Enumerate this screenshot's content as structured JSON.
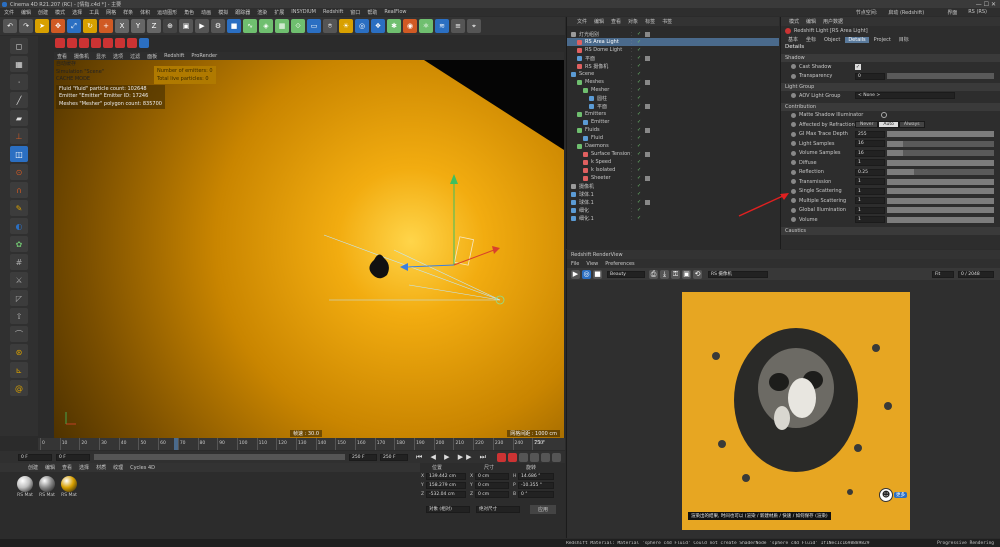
{
  "window": {
    "title": "Cinema 4D R21.207 (RC) - [情指.c4d *] - 主要"
  },
  "menu": [
    "文件",
    "编辑",
    "创建",
    "模式",
    "选择",
    "工具",
    "网格",
    "样条",
    "体积",
    "运动图形",
    "角色",
    "动画",
    "模拟",
    "跟踪器",
    "渲染",
    "扩展",
    "INSYDIUM",
    "Redshift",
    "窗口",
    "帮助",
    "RealFlow"
  ],
  "top_right": {
    "layout_label": "界面",
    "layout_value": "启动 (Redshift)",
    "node_label": "节点空间:",
    "node_value": "RS (RS)"
  },
  "viewport": {
    "menu": [
      "查看",
      "摄像机",
      "显示",
      "选项",
      "过滤",
      "面板",
      "Redshift",
      "ProRender"
    ],
    "sim_info": [
      "Simulation \"Scene\"",
      "CACHE MODE",
      "Fluid \"fluid\" particle count: 102648",
      "Emitter \"Emitter\" Emitter ID: 17246",
      "Meshes \"Mesher\" polygon count: 835700"
    ],
    "sim_info_title": "自动缓存",
    "emitters_label": "Number of emitters: 0",
    "particles_label": "Total live particles: 0",
    "speed_label": "帧速 : 30.0",
    "grid_label": "网格间距 : 1000 cm"
  },
  "timeline": {
    "ticks": [
      "0",
      "10",
      "20",
      "30",
      "40",
      "50",
      "60",
      "70",
      "80",
      "90",
      "100",
      "110",
      "120",
      "130",
      "140",
      "150",
      "160",
      "170",
      "180",
      "190",
      "200",
      "210",
      "220",
      "230",
      "240",
      "250"
    ],
    "current_frame": "73 F",
    "start": "0 F",
    "start2": "0 F",
    "end": "250 F",
    "end2": "250 F"
  },
  "materials": {
    "menu": [
      "创建",
      "编辑",
      "查看",
      "选择",
      "材质",
      "纹理",
      "Cycles 4D"
    ],
    "items": [
      {
        "name": "RS Mat",
        "color": "#bfbfbf"
      },
      {
        "name": "RS Mat",
        "color": "#8a8a8a"
      },
      {
        "name": "RS Mat",
        "color": "#d8a000"
      }
    ]
  },
  "coords": {
    "headers": [
      "位置",
      "尺寸",
      "旋转"
    ],
    "rows": [
      {
        "axis": "X",
        "pos": "139.442 cm",
        "size": "0 cm",
        "rot_axis": "H",
        "rot": "14.686 °"
      },
      {
        "axis": "Y",
        "pos": "158.279 cm",
        "size": "0 cm",
        "rot_axis": "P",
        "rot": "-10.355 °"
      },
      {
        "axis": "Z",
        "pos": "-532.04 cm",
        "size": "0 cm",
        "rot_axis": "B",
        "rot": "0 °"
      }
    ],
    "mode": "对象 (相对)",
    "size_mode": "绝对尺寸",
    "apply": "应用"
  },
  "object_manager": {
    "menu": [
      "文件",
      "编辑",
      "查看",
      "对象",
      "标签",
      "书签"
    ],
    "items": [
      {
        "name": "灯光组别",
        "indent": 0,
        "color": "#9a9a9a"
      },
      {
        "name": "RS Area Light",
        "indent": 1,
        "color": "#e06060",
        "selected": true
      },
      {
        "name": "RS Dome Light",
        "indent": 1,
        "color": "#e06060"
      },
      {
        "name": "平面",
        "indent": 1,
        "color": "#5b9bd5"
      },
      {
        "name": "RS 摄像机",
        "indent": 1,
        "color": "#e06060"
      },
      {
        "name": "Scene",
        "indent": 0,
        "color": "#5b9bd5"
      },
      {
        "name": "Meshes",
        "indent": 1,
        "color": "#6fbf6f"
      },
      {
        "name": "Mesher",
        "indent": 2,
        "color": "#6fbf6f"
      },
      {
        "name": "圆柱",
        "indent": 3,
        "color": "#5b9bd5"
      },
      {
        "name": "平面",
        "indent": 3,
        "color": "#5b9bd5"
      },
      {
        "name": "Emitters",
        "indent": 1,
        "color": "#6fbf6f"
      },
      {
        "name": "Emitter",
        "indent": 2,
        "color": "#5b9bd5"
      },
      {
        "name": "Fluids",
        "indent": 1,
        "color": "#6fbf6f"
      },
      {
        "name": "Fluid",
        "indent": 2,
        "color": "#5b9bd5"
      },
      {
        "name": "Daemons",
        "indent": 1,
        "color": "#6fbf6f"
      },
      {
        "name": "Surface Tension",
        "indent": 2,
        "color": "#e06060"
      },
      {
        "name": "k Speed",
        "indent": 2,
        "color": "#e06060"
      },
      {
        "name": "k Isolated",
        "indent": 2,
        "color": "#e06060"
      },
      {
        "name": "Sheeter",
        "indent": 2,
        "color": "#e06060"
      },
      {
        "name": "摄像机",
        "indent": 0,
        "color": "#9a9a9a"
      },
      {
        "name": "球体.1",
        "indent": 0,
        "color": "#5b9bd5"
      },
      {
        "name": "球体.1",
        "indent": 0,
        "color": "#5b9bd5"
      },
      {
        "name": "细化",
        "indent": 0,
        "color": "#5b9bd5"
      },
      {
        "name": "细化.1",
        "indent": 0,
        "color": "#5b9bd5"
      }
    ]
  },
  "attributes": {
    "menu": [
      "模式",
      "编辑",
      "用户数据"
    ],
    "object_name": "Redshift Light [RS Area Light]",
    "tabs": [
      "基本",
      "坐标",
      "Object",
      "Details",
      "Project",
      "目标"
    ],
    "active_tab": "Details",
    "heading": "Details",
    "shadow": {
      "title": "Shadow",
      "cast_shadow": "Cast Shadow",
      "transparency": "Transparency",
      "transparency_value": "0"
    },
    "light_group": {
      "title": "Light Group",
      "aov": "AOV Light Group",
      "aov_value": "< None >"
    },
    "contribution": {
      "title": "Contribution",
      "matte": "Matte Shadow Illuminator",
      "affected": "Affected by Refraction",
      "affected_opts": [
        "Never",
        "Auto",
        "Always"
      ],
      "active_opt": "Auto",
      "rows": [
        {
          "label": "GI Max Trace Depth",
          "value": "255",
          "fill": 1.0
        },
        {
          "label": "Light Samples",
          "value": "16",
          "fill": 0.15
        },
        {
          "label": "Volume Samples",
          "value": "16",
          "fill": 0.15
        },
        {
          "label": "Diffuse",
          "value": "1",
          "fill": 1.0
        },
        {
          "label": "Reflection",
          "value": "0.25",
          "fill": 0.25
        },
        {
          "label": "Transmission",
          "value": "1",
          "fill": 1.0
        },
        {
          "label": "Single Scattering",
          "value": "1",
          "fill": 1.0
        },
        {
          "label": "Multiple Scattering",
          "value": "1",
          "fill": 1.0
        },
        {
          "label": "Global Illumination",
          "value": "1",
          "fill": 1.0
        },
        {
          "label": "Volume",
          "value": "1",
          "fill": 1.0
        }
      ]
    },
    "caustics": "Caustics"
  },
  "render_view": {
    "title": "Redshift RenderView",
    "menu": [
      "File",
      "View",
      "Preferences"
    ],
    "mode": "Beauty",
    "camera": "RS 摄像机",
    "zoom": "Fit",
    "progressive": "0 / 2048",
    "subtitle": "渲染出的结果, 时间也可以 (渲染 / 新建材质 / 快速 / 如何保存 (渲染)",
    "badge": "更多"
  },
  "status_bar": {
    "text": "Redshift Material: Material 'sphere c4d Fluid' Could not create ShaderNode 'sphere c4d Fluid' 1f1Nec1c1698889829",
    "right": "Progressive Rendering"
  },
  "colors": {
    "accent": "#d8a000",
    "selection": "#4a6a8c",
    "viewport_bg": "#e8a30b"
  }
}
